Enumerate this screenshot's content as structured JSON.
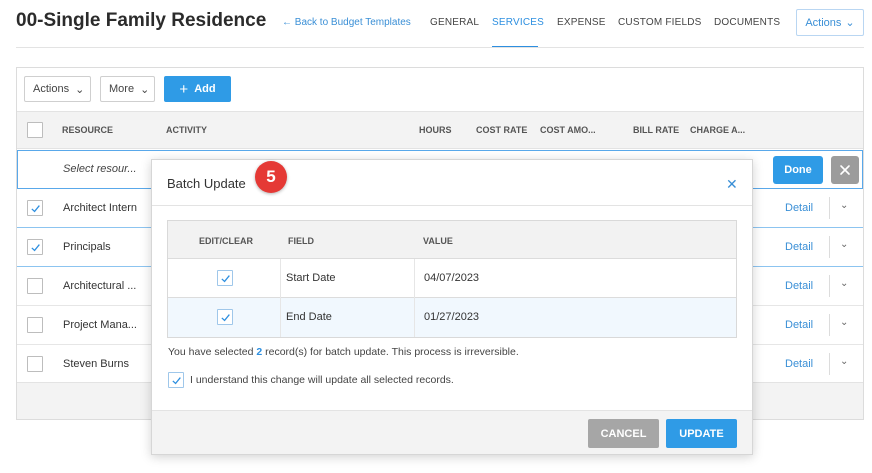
{
  "header": {
    "title": "00-Single Family Residence",
    "back_link": "Back to Budget Templates",
    "tabs": [
      {
        "label": "GENERAL"
      },
      {
        "label": "SERVICES",
        "active": true
      },
      {
        "label": "EXPENSE"
      },
      {
        "label": "CUSTOM FIELDS"
      },
      {
        "label": "DOCUMENTS"
      }
    ],
    "actions_label": "Actions"
  },
  "toolbar": {
    "actions_label": "Actions",
    "more_label": "More",
    "add_label": "Add"
  },
  "table": {
    "columns": [
      "RESOURCE",
      "ACTIVITY",
      "HOURS",
      "COST RATE",
      "COST AMO...",
      "BILL RATE",
      "CHARGE A..."
    ],
    "edit_row_placeholder": "Select resour...",
    "done_label": "Done",
    "rows": [
      {
        "name": "Architect Intern",
        "checked": true,
        "detail": "Detail"
      },
      {
        "name": "Principals",
        "checked": true,
        "detail": "Detail"
      },
      {
        "name": "Architectural ...",
        "checked": false,
        "detail": "Detail"
      },
      {
        "name": "Project Mana...",
        "checked": false,
        "detail": "Detail"
      },
      {
        "name": "Steven Burns",
        "checked": false,
        "detail": "Detail"
      }
    ]
  },
  "modal": {
    "title": "Batch Update",
    "step_badge": "5",
    "columns": [
      "EDIT/CLEAR",
      "FIELD",
      "VALUE"
    ],
    "rows": [
      {
        "checked": true,
        "field": "Start Date",
        "value": "04/07/2023"
      },
      {
        "checked": true,
        "field": "End Date",
        "value": "01/27/2023"
      }
    ],
    "info_prefix": "You have selected ",
    "info_count": "2",
    "info_suffix": " record(s) for batch update. This process is irreversible.",
    "acknowledge_label": "I understand this change will update all selected records.",
    "acknowledge_checked": true,
    "cancel_label": "CANCEL",
    "update_label": "UPDATE"
  },
  "colors": {
    "accent": "#2f9be6",
    "badge": "#e53935",
    "cancel": "#a6a6a6"
  }
}
